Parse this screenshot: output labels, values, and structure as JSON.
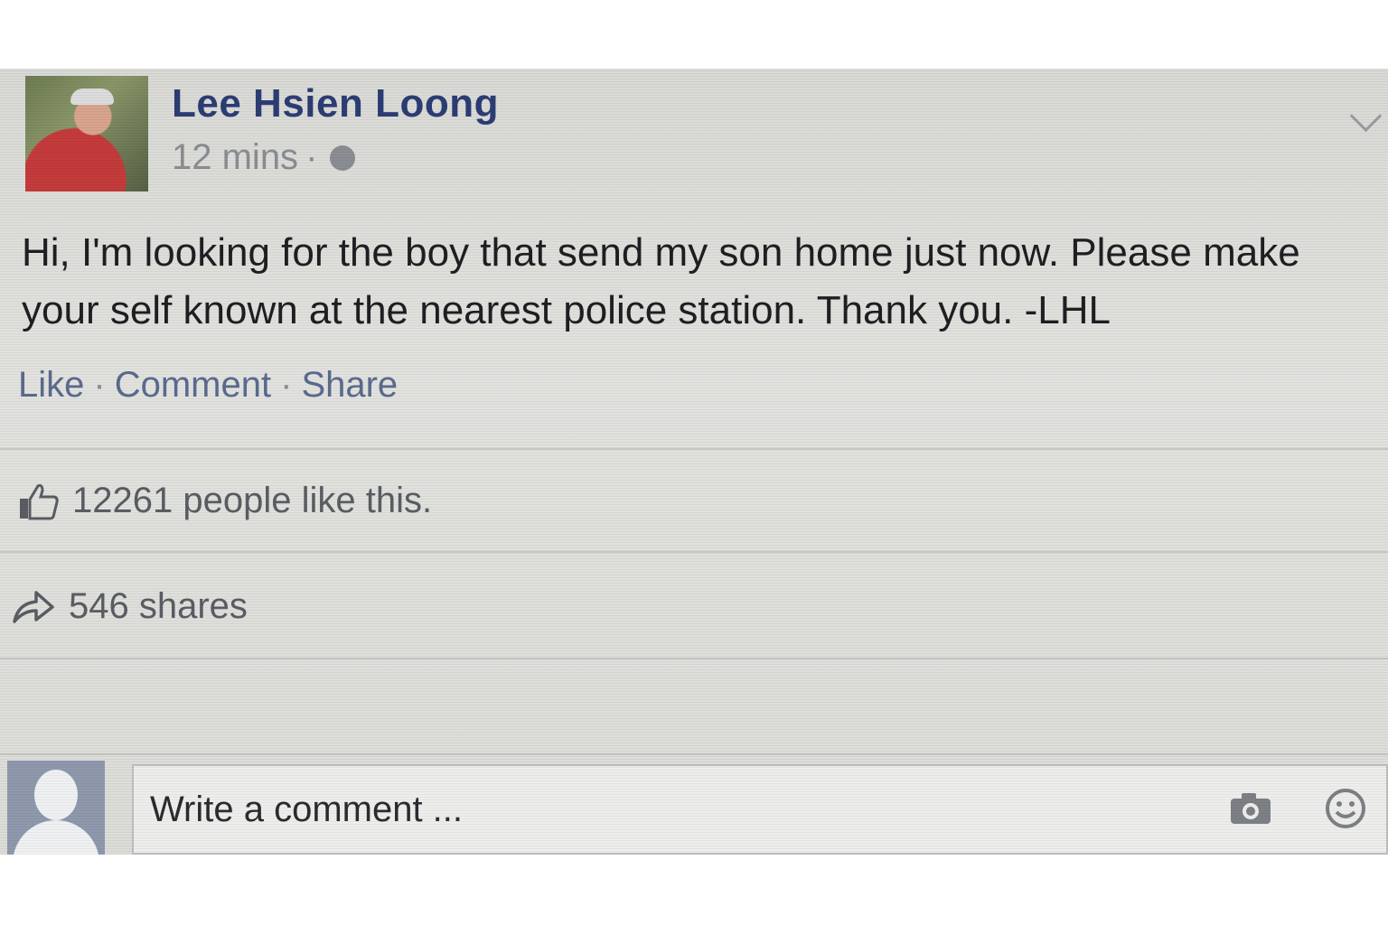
{
  "post": {
    "author": "Lee Hsien Loong",
    "time": "12 mins",
    "meta_separator": "·",
    "text": "Hi, I'm looking for the boy that send my son home just now. Please make your self known at the nearest police station. Thank you. -LHL",
    "actions": {
      "like": "Like",
      "comment": "Comment",
      "share": "Share",
      "separator": "·"
    },
    "likes_text": "12261 people like this.",
    "shares_text": "546 shares"
  },
  "comment": {
    "placeholder": "Write a comment ..."
  },
  "icons": {
    "privacy": "globe-icon",
    "options": "chevron-down-icon",
    "likes": "thumbs-up-icon",
    "shares": "share-arrow-icon",
    "photo": "camera-icon",
    "emoji": "smiley-icon"
  },
  "colors": {
    "author_name": "#2c3d74",
    "action_link": "#5b6a8f",
    "meta_text": "#8a8d92"
  }
}
